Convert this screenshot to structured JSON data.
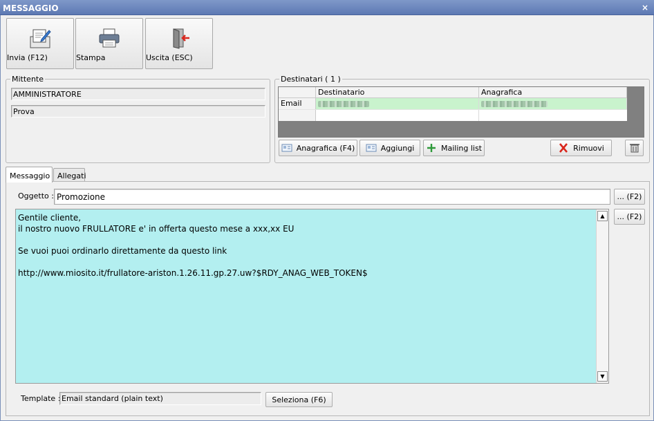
{
  "window": {
    "title": "MESSAGGIO",
    "close_symbol": "×"
  },
  "toolbar": {
    "send_label": "Invia (F12)",
    "print_label": "Stampa",
    "exit_label": "Uscita (ESC)"
  },
  "sender": {
    "group_title": "Mittente",
    "name": "AMMINISTRATORE",
    "subtitle": "Prova"
  },
  "recipients": {
    "group_title": "Destinatari ( 1 )",
    "columns": [
      "Destinatario",
      "Anagrafica"
    ],
    "rows": [
      {
        "type": "Email",
        "recipient": "",
        "registry": ""
      }
    ],
    "anagrafica_button": "Anagrafica (F4)",
    "add_button": "Aggiungi",
    "mailing_list_button": "Mailing list",
    "remove_button": "Rimuovi"
  },
  "tabs": [
    {
      "label": "Messaggio",
      "active": true
    },
    {
      "label": "Allegati",
      "active": false
    }
  ],
  "message": {
    "subject_label": "Oggetto :",
    "subject": "Promozione",
    "subject_button": "... (F2)",
    "body_button": "... (F2)",
    "body_lines": [
      "Gentile cliente,",
      "il nostro nuovo FRULLATORE e' in offerta questo mese a xxx,xx EU",
      "",
      "Se vuoi puoi ordinarlo direttamente da questo link",
      "",
      "http://www.miosito.it/frullatore-ariston.1.26.11.gp.27.uw?$RDY_ANAG_WEB_TOKEN$"
    ],
    "template_label": "Template :",
    "template_value": "Email standard (plain text)",
    "template_button": "Seleziona (F6)"
  },
  "colors": {
    "titlebar": "#6d87bd",
    "body_bg": "#b3eff0",
    "selected_row": "#c9f3cd",
    "remove_icon": "#d9261c",
    "add_icon": "#2e9a3a"
  }
}
